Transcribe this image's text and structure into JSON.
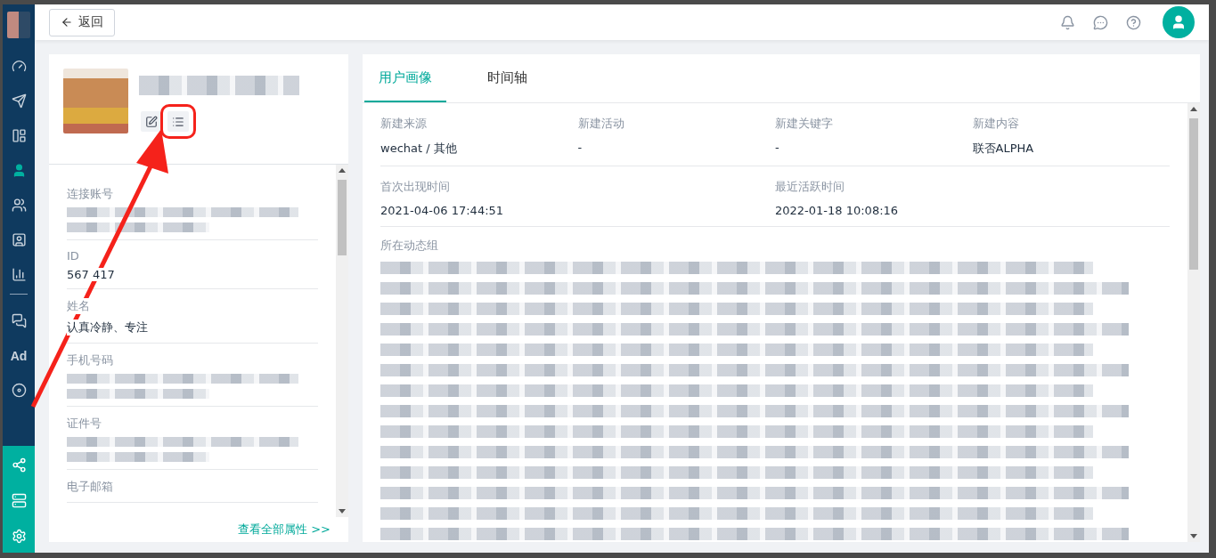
{
  "sidebar": {
    "main_items": [
      {
        "kind": "icon",
        "selected": false
      },
      {
        "kind": "icon",
        "selected": false
      },
      {
        "kind": "icon",
        "selected": false
      },
      {
        "kind": "icon",
        "selected": true
      },
      {
        "kind": "icon",
        "selected": false
      },
      {
        "kind": "icon",
        "selected": false
      },
      {
        "kind": "icon",
        "selected": false
      },
      {
        "kind": "divider"
      },
      {
        "kind": "icon",
        "selected": false
      },
      {
        "kind": "text",
        "label": "Ad",
        "selected": false
      },
      {
        "kind": "icon",
        "selected": false
      }
    ],
    "tool_items": [
      {
        "kind": "icon",
        "selected": false
      },
      {
        "kind": "icon",
        "selected": false
      },
      {
        "kind": "icon",
        "selected": false
      }
    ]
  },
  "header": {
    "back_button": "返回"
  },
  "profile": {
    "fields": [
      {
        "label": "连接账号",
        "kind": "blurred"
      },
      {
        "label": "ID",
        "kind": "text",
        "value": "567 417"
      },
      {
        "label": "姓名",
        "kind": "text",
        "value": "认真冷静、专注"
      },
      {
        "label": "手机号码",
        "kind": "blurred"
      },
      {
        "label": "证件号",
        "kind": "blurred"
      },
      {
        "label": "电子邮箱",
        "kind": "text"
      }
    ],
    "footer_link": "查看全部属性 >>"
  },
  "tabs": [
    {
      "label": "用户画像",
      "selected": true
    },
    {
      "label": "时间轴",
      "selected": false
    }
  ],
  "details": {
    "rows": [
      [
        {
          "label": "新建来源",
          "value": "wechat / 其他"
        },
        {
          "label": "新建活动",
          "value": "-"
        },
        {
          "label": "新建关键字",
          "value": "-"
        },
        {
          "label": "新建内容",
          "value": "联否ALPHA"
        }
      ],
      [
        {
          "label": "首次出现时间",
          "value": "2021-04-06 17:44:51"
        },
        null,
        {
          "label": "最近活跃时间",
          "value": "2022-01-18 10:08:16"
        },
        null
      ]
    ],
    "group_label": "所在动态组"
  }
}
